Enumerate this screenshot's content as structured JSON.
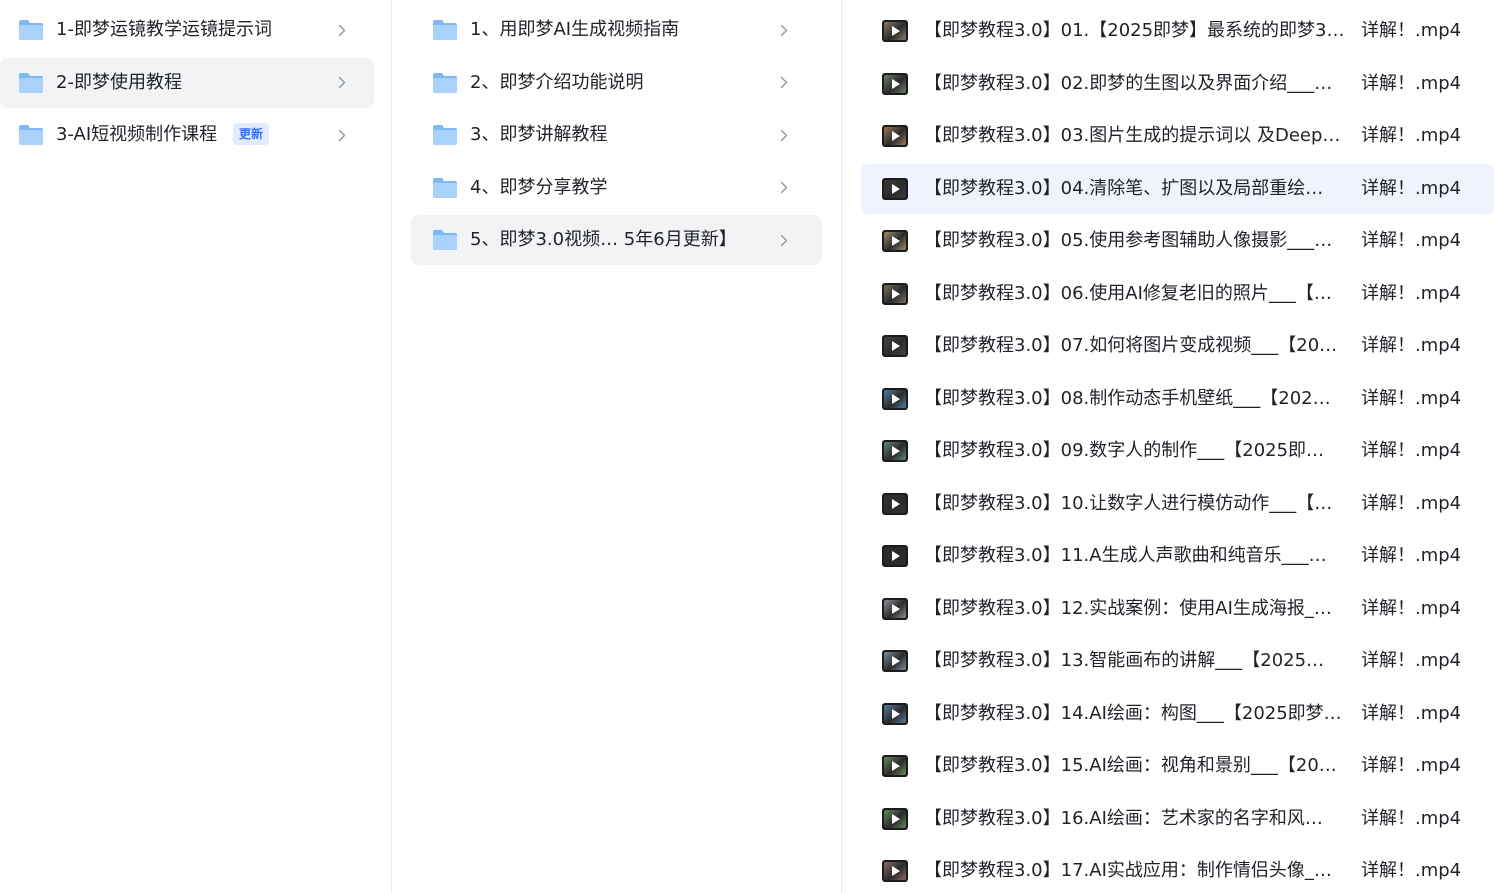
{
  "accent": "#3370ff",
  "columns": [
    {
      "items": [
        {
          "label": "1-即梦运镜教学运镜提示词",
          "icon": "folder-icon",
          "selected": false
        },
        {
          "label": "2-即梦使用教程",
          "icon": "folder-icon",
          "selected": true
        },
        {
          "label": "3-AI短视频制作课程",
          "icon": "folder-icon",
          "selected": false,
          "badge": "更新"
        }
      ]
    },
    {
      "items": [
        {
          "label": "1、用即梦AI生成视频指南",
          "icon": "folder-icon",
          "selected": false
        },
        {
          "label": "2、即梦介绍功能说明",
          "icon": "folder-icon",
          "selected": false
        },
        {
          "label": "3、即梦讲解教程",
          "icon": "folder-icon",
          "selected": false
        },
        {
          "label": "4、即梦分享教学",
          "icon": "folder-icon",
          "selected": false
        },
        {
          "label": "5、即梦3.0视频… 5年6月更新】",
          "icon": "folder-icon",
          "selected": true
        }
      ]
    }
  ],
  "files": [
    {
      "name": "【即梦教程3.0】01.【2025即梦】最系统的即梦3…",
      "ext": "详解！.mp4",
      "selected": false,
      "icon": "video-thumbnail-icon",
      "thumb_color": "#8a7a6a"
    },
    {
      "name": "【即梦教程3.0】02.即梦的生图以及界面介绍___…",
      "ext": "详解！.mp4",
      "selected": false,
      "icon": "video-thumbnail-icon",
      "thumb_color": "#6f7f6a"
    },
    {
      "name": "【即梦教程3.0】03.图片生成的提示词以 及Deep…",
      "ext": "详解！.mp4",
      "selected": false,
      "icon": "video-thumbnail-icon",
      "thumb_color": "#9a7a5a"
    },
    {
      "name": "【即梦教程3.0】04.清除笔、扩图以及局部重绘…",
      "ext": "详解！.mp4",
      "selected": true,
      "icon": "video-thumbnail-icon",
      "thumb_color": "#3a3a3a"
    },
    {
      "name": "【即梦教程3.0】05.使用参考图辅助人像摄影___…",
      "ext": "详解！.mp4",
      "selected": false,
      "icon": "video-thumbnail-icon",
      "thumb_color": "#a08c70"
    },
    {
      "name": "【即梦教程3.0】06.使用AI修复老旧的照片___【…",
      "ext": "详解！.mp4",
      "selected": false,
      "icon": "video-thumbnail-icon",
      "thumb_color": "#7a7062"
    },
    {
      "name": "【即梦教程3.0】07.如何将图片变成视频___【20…",
      "ext": "详解！.mp4",
      "selected": false,
      "icon": "video-thumbnail-icon",
      "thumb_color": "#444444"
    },
    {
      "name": "【即梦教程3.0】08.制作动态手机壁纸___【202…",
      "ext": "详解！.mp4",
      "selected": false,
      "icon": "video-thumbnail-icon",
      "thumb_color": "#4e7fa8"
    },
    {
      "name": "【即梦教程3.0】09.数字人的制作___【2025即…",
      "ext": "详解！.mp4",
      "selected": false,
      "icon": "video-thumbnail-icon",
      "thumb_color": "#5f8a7a"
    },
    {
      "name": "【即梦教程3.0】10.让数字人进行模仿动作___【…",
      "ext": "详解！.mp4",
      "selected": false,
      "icon": "video-thumbnail-icon",
      "thumb_color": "#333333"
    },
    {
      "name": "【即梦教程3.0】11.A生成人声歌曲和纯音乐___…",
      "ext": "详解！.mp4",
      "selected": false,
      "icon": "video-thumbnail-icon",
      "thumb_color": "#2e2e2e"
    },
    {
      "name": "【即梦教程3.0】12.实战案例：使用AI生成海报_…",
      "ext": "详解！.mp4",
      "selected": false,
      "icon": "video-thumbnail-icon",
      "thumb_color": "#8e9098"
    },
    {
      "name": "【即梦教程3.0】13.智能画布的讲解___【2025…",
      "ext": "详解！.mp4",
      "selected": false,
      "icon": "video-thumbnail-icon",
      "thumb_color": "#7d8fa2"
    },
    {
      "name": "【即梦教程3.0】14.AI绘画：构图___【2025即梦…",
      "ext": "详解！.mp4",
      "selected": false,
      "icon": "video-thumbnail-icon",
      "thumb_color": "#5a7aa0"
    },
    {
      "name": "【即梦教程3.0】15.AI绘画：视角和景别___【20…",
      "ext": "详解！.mp4",
      "selected": false,
      "icon": "video-thumbnail-icon",
      "thumb_color": "#6a8a5a"
    },
    {
      "name": "【即梦教程3.0】16.AI绘画：艺术家的名字和风…",
      "ext": "详解！.mp4",
      "selected": false,
      "icon": "video-thumbnail-icon",
      "thumb_color": "#5e8a5e"
    },
    {
      "name": "【即梦教程3.0】17.AI实战应用：制作情侣头像_…",
      "ext": "详解！.mp4",
      "selected": false,
      "icon": "video-thumbnail-icon",
      "thumb_color": "#8a6e6e"
    }
  ]
}
